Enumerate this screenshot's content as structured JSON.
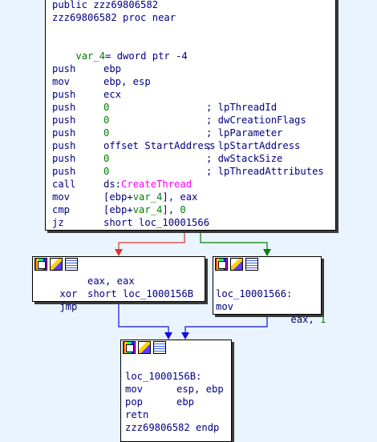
{
  "colors": {
    "background": "#eaf4ff",
    "instruction": "#000080",
    "number": "#008000",
    "api": "#ff00ff",
    "edge_false": "#e03030",
    "edge_true": "#007f00",
    "edge_jump": "#1010e0"
  },
  "blocks": {
    "main": {
      "header_line1": "public zzz69806582",
      "header_line2": "zzz69806582 proc near",
      "var_name": "var_4",
      "var_def": "= dword ptr -4",
      "rows": [
        {
          "m": "push",
          "op": "ebp",
          "cmt": ""
        },
        {
          "m": "mov",
          "op": "ebp, esp",
          "cmt": ""
        },
        {
          "m": "push",
          "op": "ecx",
          "cmt": ""
        },
        {
          "m": "push",
          "op": "0",
          "cmt": "; lpThreadId"
        },
        {
          "m": "push",
          "op": "0",
          "cmt": "; dwCreationFlags"
        },
        {
          "m": "push",
          "op": "0",
          "cmt": "; lpParameter"
        },
        {
          "m": "push",
          "op": "offset StartAddress",
          "cmt": "; lpStartAddress"
        },
        {
          "m": "push",
          "op": "0",
          "cmt": "; dwStackSize"
        },
        {
          "m": "push",
          "op": "0",
          "cmt": "; lpThreadAttributes"
        },
        {
          "m": "call",
          "op_prefix": "ds:",
          "op_api": "CreateThread",
          "cmt": ""
        },
        {
          "m": "mov",
          "op_a": "[ebp+",
          "op_var": "var_4",
          "op_b": "], eax",
          "cmt": ""
        },
        {
          "m": "cmp",
          "op_a": "[ebp+",
          "op_var": "var_4",
          "op_b": "], ",
          "op_num": "0",
          "cmt": ""
        },
        {
          "m": "jz",
          "op": "short loc_10001566",
          "cmt": ""
        }
      ]
    },
    "left": {
      "rows": [
        {
          "m": "xor",
          "op": "eax, eax"
        },
        {
          "m": "jmp",
          "op": "short loc_1000156B"
        }
      ]
    },
    "right": {
      "label": "loc_10001566:",
      "row": {
        "m": "mov",
        "op": "eax, ",
        "num": "1"
      }
    },
    "bottom": {
      "label": "loc_1000156B:",
      "rows": [
        {
          "m": "mov",
          "op": "esp, ebp"
        },
        {
          "m": "pop",
          "op": "ebp"
        },
        {
          "m": "retn",
          "op": ""
        }
      ],
      "footer": "zzz69806582 endp"
    }
  }
}
